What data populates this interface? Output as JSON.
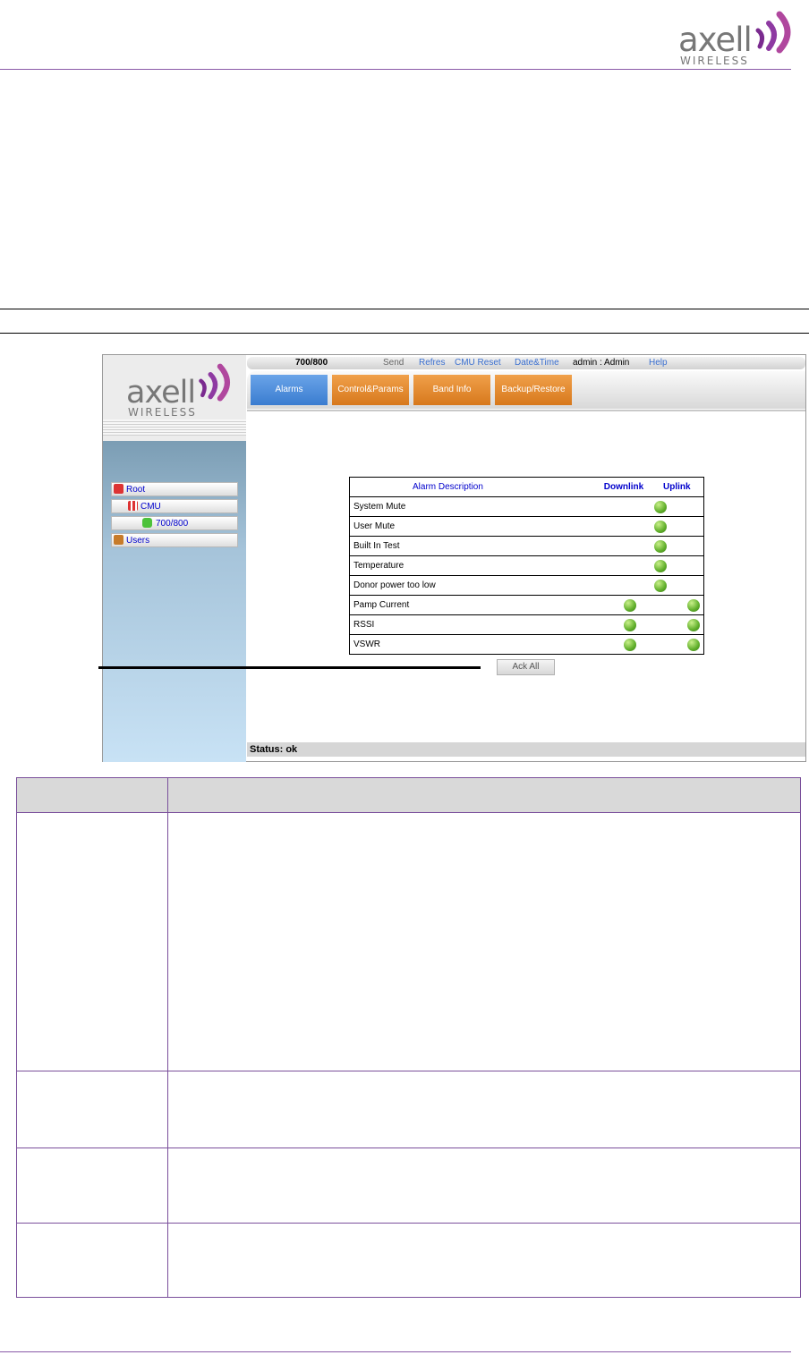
{
  "page_header": {
    "logo_word": "axell",
    "logo_sub": "WIRELESS"
  },
  "app": {
    "logo_word": "axell",
    "logo_sub": "WIRELESS",
    "topbar": {
      "device": "700/800",
      "send": "Send",
      "refresh": "Refres",
      "cmu_reset": "CMU Reset",
      "date_time": "Date&Time",
      "user": "admin : Admin",
      "help": "Help"
    },
    "tabs": [
      {
        "label": "Alarms"
      },
      {
        "label": "Control&Params"
      },
      {
        "label": "Band Info"
      },
      {
        "label": "Backup/Restore"
      }
    ],
    "tree": {
      "root": "Root",
      "cmu": "CMU",
      "device": "700/800",
      "users": "Users"
    },
    "alarm_table": {
      "headers": [
        "Alarm Description",
        "Downlink",
        "Uplink"
      ],
      "rows": [
        {
          "name": "System Mute",
          "downlink": "",
          "uplink": "",
          "single": true
        },
        {
          "name": "User Mute",
          "downlink": "",
          "uplink": "",
          "single": true
        },
        {
          "name": "Built In Test",
          "downlink": "",
          "uplink": "",
          "single": true
        },
        {
          "name": "Temperature",
          "downlink": "",
          "uplink": "",
          "single": true
        },
        {
          "name": "Donor power too low",
          "downlink": "",
          "uplink": "",
          "single": true
        },
        {
          "name": "Pamp Current",
          "downlink": "green",
          "uplink": "green",
          "single": false
        },
        {
          "name": "RSSI",
          "downlink": "green",
          "uplink": "green",
          "single": false
        },
        {
          "name": "VSWR",
          "downlink": "green",
          "uplink": "green",
          "single": false
        }
      ],
      "led_color": "#5fae2a"
    },
    "ack_all_label": "Ack All",
    "status": "Status: ok"
  },
  "colors": {
    "accent_purple": "#8a5aa8",
    "tab_blue": "#3a7cd0",
    "tab_orange": "#d7781c"
  }
}
